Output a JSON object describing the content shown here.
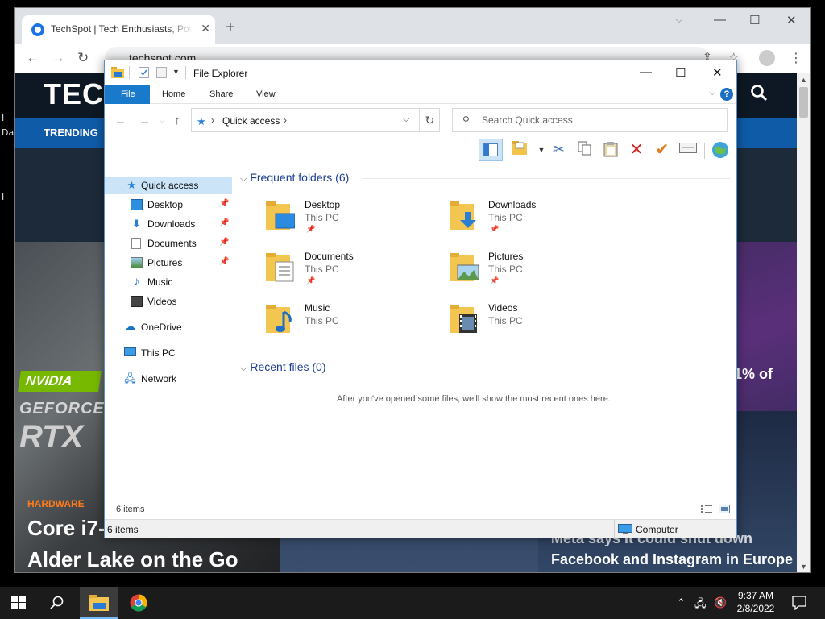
{
  "chrome": {
    "tab_title": "TechSpot | Tech Enthusiasts, Power Users, Gamers",
    "url": "techspot.com"
  },
  "website": {
    "logo": "TEC",
    "nav_item": "TRENDING",
    "category": "HARDWARE",
    "headline_left_line1": "Core i7-",
    "headline_left_line2": "Alder Lake on the Go",
    "headline_right_line1": "Meta says it could shut down",
    "headline_right_line2": "Facebook and Instagram in Europe",
    "right_fragment": "1% of",
    "nvidia_badge": "NVIDIA",
    "geforce_text": "GEFORCE",
    "rtx_text": "RTX"
  },
  "desktop": {
    "frag1": "I",
    "frag2": "Da",
    "frag3": "I"
  },
  "explorer": {
    "title": "File Explorer",
    "ribbon_tabs": [
      "File",
      "Home",
      "Share",
      "View"
    ],
    "address_location": "Quick access",
    "search_placeholder": "Search Quick access",
    "sidebar": [
      {
        "label": "Quick access",
        "pinned": false
      },
      {
        "label": "Desktop",
        "pinned": true
      },
      {
        "label": "Downloads",
        "pinned": true
      },
      {
        "label": "Documents",
        "pinned": true
      },
      {
        "label": "Pictures",
        "pinned": true
      },
      {
        "label": "Music",
        "pinned": false
      },
      {
        "label": "Videos",
        "pinned": false
      },
      {
        "label": "OneDrive",
        "pinned": false
      },
      {
        "label": "This PC",
        "pinned": false
      },
      {
        "label": "Network",
        "pinned": false
      }
    ],
    "frequent_header": "Frequent folders (6)",
    "recent_header": "Recent files (0)",
    "folders": [
      {
        "name": "Desktop",
        "location": "This PC"
      },
      {
        "name": "Downloads",
        "location": "This PC"
      },
      {
        "name": "Documents",
        "location": "This PC"
      },
      {
        "name": "Pictures",
        "location": "This PC"
      },
      {
        "name": "Music",
        "location": "This PC"
      },
      {
        "name": "Videos",
        "location": "This PC"
      }
    ],
    "empty_message": "After you've opened some files, we'll show the most recent ones here.",
    "item_count": "6 items",
    "status_count": "6 items",
    "status_location": "Computer"
  },
  "taskbar": {
    "time": "9:37 AM",
    "date": "2/8/2022"
  }
}
